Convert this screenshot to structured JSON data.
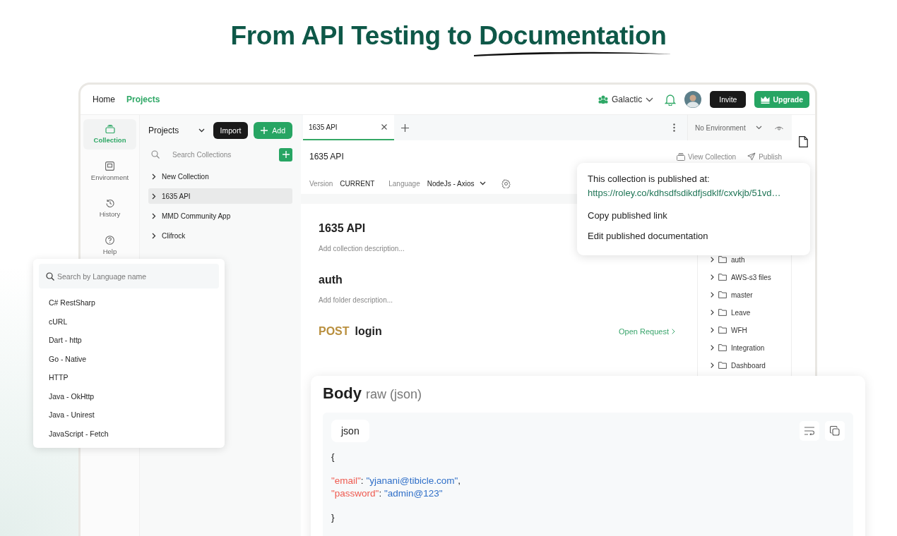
{
  "headline": {
    "text": "From API Testing to ",
    "highlight": "Documentation"
  },
  "nav": {
    "links": [
      {
        "label": "Home",
        "selected": false
      },
      {
        "label": "Projects",
        "selected": true
      }
    ],
    "workspace": "Galactic",
    "invite": "Invite",
    "upgrade": "Upgrade"
  },
  "rail": [
    {
      "label": "Collection",
      "kind": "collection",
      "selected": true
    },
    {
      "label": "Environment",
      "kind": "environment",
      "selected": false
    },
    {
      "label": "History",
      "kind": "history",
      "selected": false
    },
    {
      "label": "Help",
      "kind": "help",
      "selected": false
    }
  ],
  "projects": {
    "title": "Projects",
    "import": "Import",
    "add": "Add",
    "search_placeholder": "Search Collections",
    "items": [
      {
        "label": "New Collection",
        "selected": false
      },
      {
        "label": "1635 API",
        "selected": true
      },
      {
        "label": "MMD Community App",
        "selected": false
      },
      {
        "label": "Clifrock",
        "selected": false
      }
    ]
  },
  "tabs": [
    {
      "label": "1635 API",
      "selected": true
    }
  ],
  "environment": "No Environment",
  "collection_header": {
    "title": "1635 API",
    "view": "View Collection",
    "publish": "Publish"
  },
  "meta": {
    "version_label": "Version",
    "version": "CURRENT",
    "language_label": "Language",
    "language": "NodeJs - Axios"
  },
  "docs": [
    {
      "kind": "collection",
      "title": "1635 API",
      "description": "Add collection description..."
    },
    {
      "kind": "folder",
      "title": "auth",
      "description": "Add folder description..."
    },
    {
      "kind": "request",
      "method": "POST",
      "title": "login",
      "action": "Open Request"
    }
  ],
  "folders": [
    {
      "label": "auth"
    },
    {
      "label": "AWS-s3 files"
    },
    {
      "label": "master"
    },
    {
      "label": "Leave"
    },
    {
      "label": "WFH"
    },
    {
      "label": "Integration"
    },
    {
      "label": "Dashboard"
    }
  ],
  "publish_popover": {
    "heading": "This collection is published at:",
    "url": "https://roley.co/kdhsdfsdikdfjsdklf/cxvkjb/51vd…",
    "actions": [
      "Copy published link",
      "Edit published documentation"
    ]
  },
  "language_menu": {
    "placeholder": "Search by Language name",
    "options": [
      "C# RestSharp",
      "cURL",
      "Dart - http",
      "Go - Native",
      "HTTP",
      "Java - OkHttp",
      "Java - Unirest",
      "JavaScript - Fetch"
    ]
  },
  "body_card": {
    "title": "Body",
    "subtitle": "raw (json)",
    "format": "json",
    "code": [
      {
        "kind": "text",
        "text": "{"
      },
      {
        "kind": "blank"
      },
      {
        "kind": "pair",
        "key": "\"email\"",
        "sep": ": ",
        "value": "\"yjanani@tibicle.com\"",
        "trail": ","
      },
      {
        "kind": "pair",
        "key": "\"password\"",
        "sep": ": ",
        "value": "\"admin@123\""
      },
      {
        "kind": "blank"
      },
      {
        "kind": "text",
        "text": "}"
      }
    ]
  }
}
